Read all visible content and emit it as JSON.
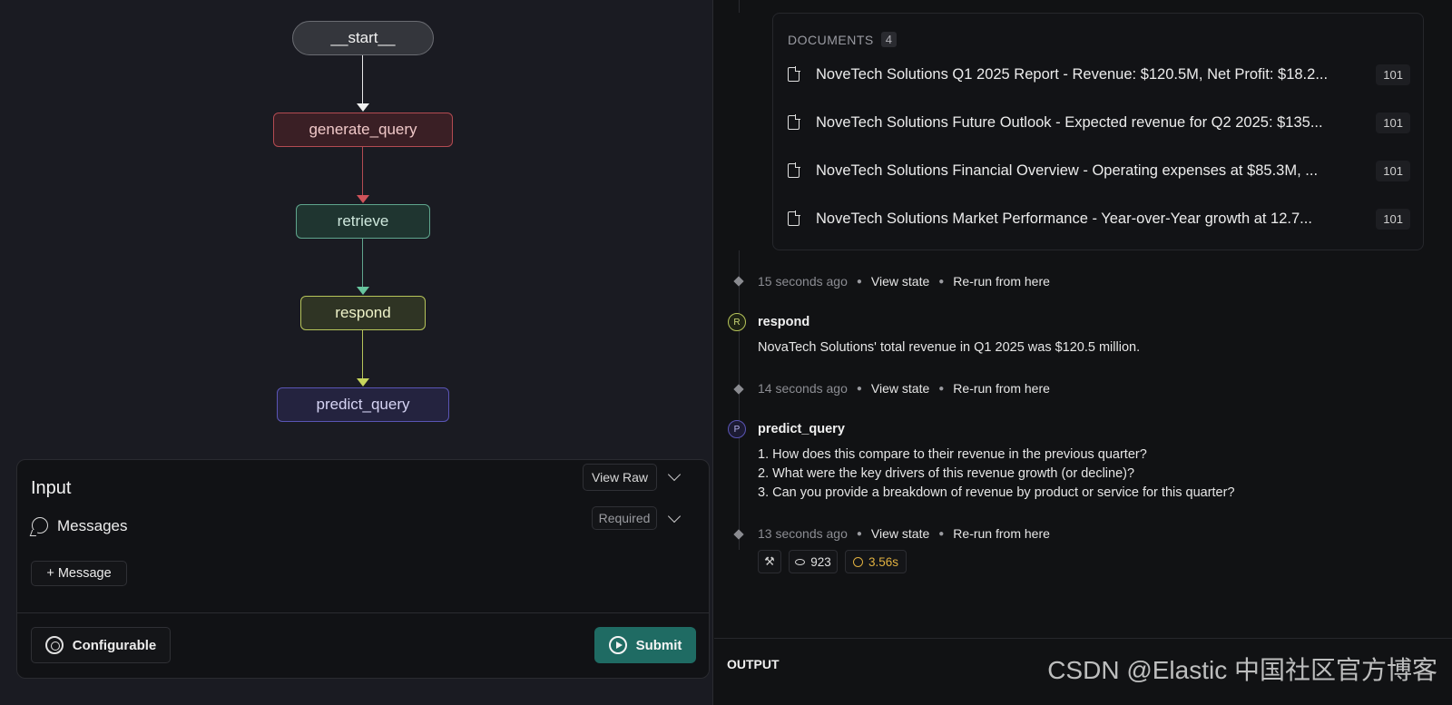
{
  "graph": {
    "nodes": [
      "__start__",
      "generate_query",
      "retrieve",
      "respond",
      "predict_query"
    ]
  },
  "input_panel": {
    "title": "Input",
    "view_raw_label": "View Raw",
    "messages_label": "Messages",
    "required_label": "Required",
    "add_message_label": "+ Message",
    "configurable_label": "Configurable",
    "submit_label": "Submit"
  },
  "documents": {
    "header": "DOCUMENTS",
    "count": "4",
    "items": [
      {
        "title": "NoveTech Solutions Q1 2025 Report - Revenue: $120.5M, Net Profit: $18.2...",
        "badge": "101"
      },
      {
        "title": "NoveTech Solutions Future Outlook - Expected revenue for Q2 2025: $135...",
        "badge": "101"
      },
      {
        "title": "NoveTech Solutions Financial Overview - Operating expenses at $85.3M, ...",
        "badge": "101"
      },
      {
        "title": "NoveTech Solutions Market Performance - Year-over-Year growth at 12.7...",
        "badge": "101"
      }
    ]
  },
  "timeline": {
    "steps": [
      {
        "ago": "15 seconds ago",
        "view_state": "View state",
        "rerun": "Re-run from here"
      },
      {
        "ago": "14 seconds ago",
        "view_state": "View state",
        "rerun": "Re-run from here"
      },
      {
        "ago": "13 seconds ago",
        "view_state": "View state",
        "rerun": "Re-run from here"
      }
    ],
    "respond": {
      "initial": "R",
      "name": "respond",
      "text": "NovaTech Solutions' total revenue in Q1 2025 was $120.5 million."
    },
    "predict_query": {
      "initial": "P",
      "name": "predict_query",
      "lines": [
        "1. How does this compare to their revenue in the previous quarter?",
        "2. What were the key drivers of this revenue growth (or decline)?",
        "3. Can you provide a breakdown of revenue by product or service for this quarter?"
      ]
    },
    "stats": {
      "tokens": "923",
      "latency": "3.56s"
    }
  },
  "output": {
    "label": "OUTPUT",
    "watermark": "CSDN @Elastic 中国社区官方博客"
  },
  "colors": {
    "generate_query": "#b34b52",
    "retrieve": "#5fa58d",
    "respond": "#b6c45a",
    "predict_query": "#5a55b5",
    "submit": "#1f6b63",
    "latency": "#e0b040"
  }
}
